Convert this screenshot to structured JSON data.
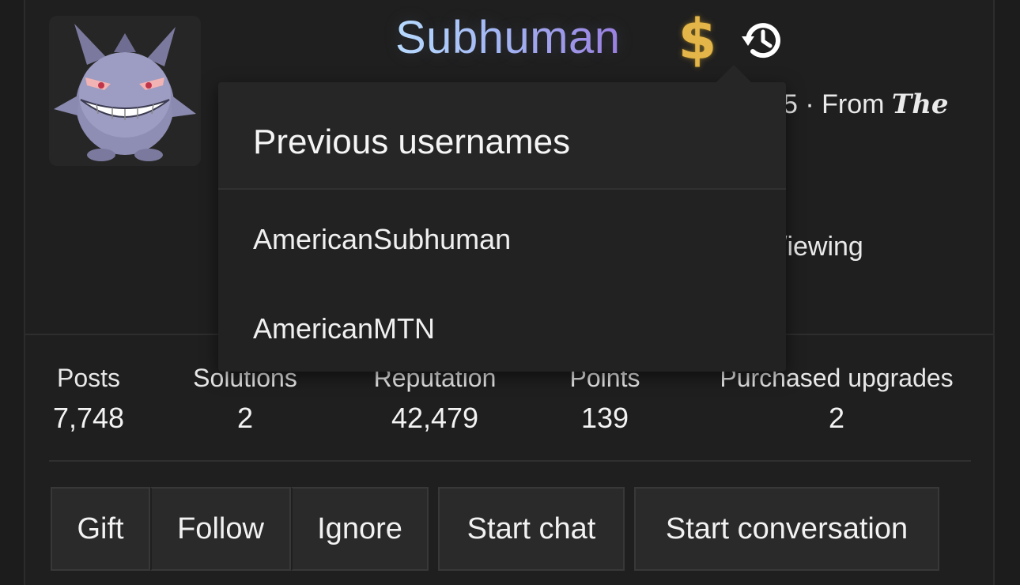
{
  "profile": {
    "username": "Subhuman",
    "badge_icon": "dollar-icon",
    "history_icon": "history-icon",
    "meta_partial": "5 · From ",
    "meta_location_partial": "The",
    "status_partial": "/iewing",
    "colors": {
      "username_gradient_start": "#b9dcff",
      "username_gradient_end": "#9a7ee0",
      "badge_gold": "#e4b64a"
    }
  },
  "previous_usernames_popup": {
    "title": "Previous usernames",
    "items": [
      "AmericanSubhuman",
      "AmericanMTN"
    ]
  },
  "stats": [
    {
      "label": "Posts",
      "value": "7,748"
    },
    {
      "label": "Solutions",
      "value": "2"
    },
    {
      "label": "Reputation",
      "value": "42,479"
    },
    {
      "label": "Points",
      "value": "139"
    },
    {
      "label": "Purchased upgrades",
      "value": "2"
    }
  ],
  "actions": {
    "gift": "Gift",
    "follow": "Follow",
    "ignore": "Ignore",
    "start_chat": "Start chat",
    "start_conversation": "Start conversation"
  }
}
